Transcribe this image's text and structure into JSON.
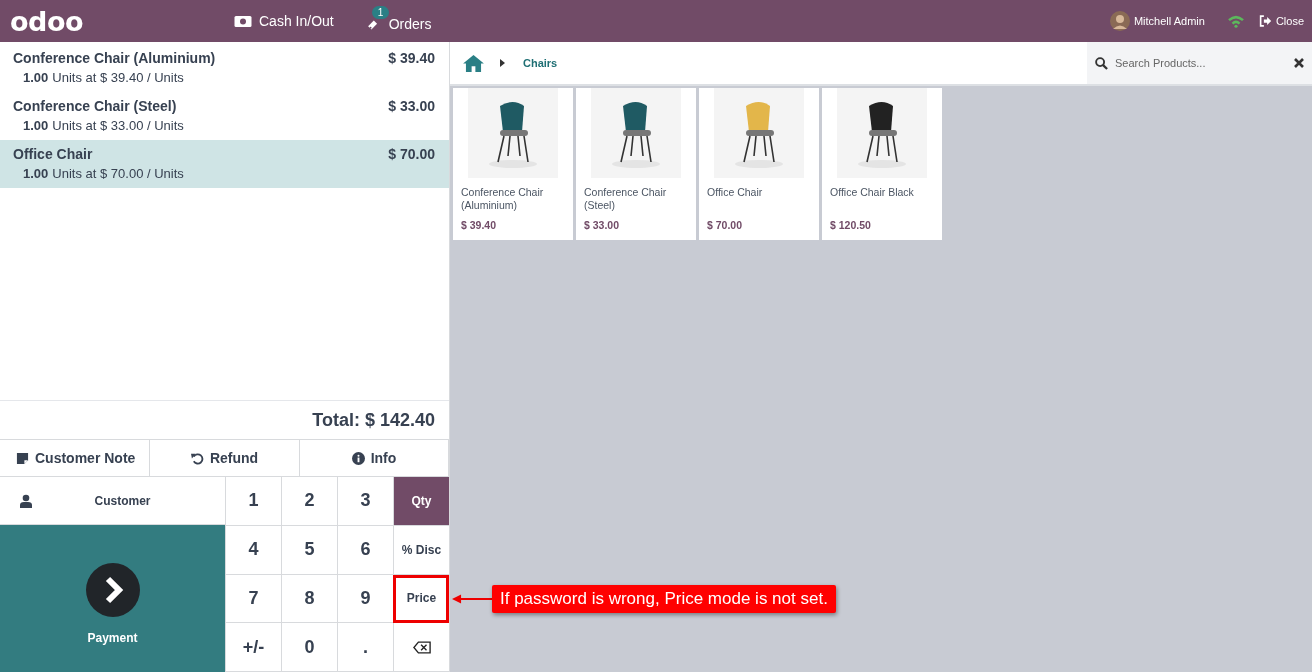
{
  "header": {
    "logo": "odoo",
    "cash_button": "Cash In/Out",
    "orders_button": {
      "label": "Orders",
      "badge": "1"
    },
    "user": "Mitchell Admin",
    "close_button": "Close"
  },
  "order_lines": [
    {
      "name": "Conference Chair (Aluminium)",
      "price": "$ 39.40",
      "quantity": "1.00",
      "detail": "Units at $ 39.40 / Units",
      "selected": false
    },
    {
      "name": "Conference Chair (Steel)",
      "price": "$ 33.00",
      "quantity": "1.00",
      "detail": "Units at $ 33.00 / Units",
      "selected": false
    },
    {
      "name": "Office Chair",
      "price": "$ 70.00",
      "quantity": "1.00",
      "detail": "Units at $ 70.00 / Units",
      "selected": true
    }
  ],
  "total": "Total: $ 142.40",
  "control_buttons": [
    {
      "kind": "note",
      "label": "Customer Note"
    },
    {
      "kind": "refund",
      "label": "Refund"
    },
    {
      "kind": "info",
      "label": "Info"
    }
  ],
  "customer_button": "Customer",
  "payment_button": "Payment",
  "numpad": [
    {
      "kind": "digit",
      "label": "1"
    },
    {
      "kind": "digit",
      "label": "2"
    },
    {
      "kind": "digit",
      "label": "3"
    },
    {
      "kind": "mode",
      "label": "Qty",
      "selected": true,
      "annotated": false
    },
    {
      "kind": "digit",
      "label": "4"
    },
    {
      "kind": "digit",
      "label": "5"
    },
    {
      "kind": "digit",
      "label": "6"
    },
    {
      "kind": "mode",
      "label": "% Disc",
      "selected": false,
      "annotated": false
    },
    {
      "kind": "digit",
      "label": "7"
    },
    {
      "kind": "digit",
      "label": "8"
    },
    {
      "kind": "digit",
      "label": "9"
    },
    {
      "kind": "mode",
      "label": "Price",
      "selected": false,
      "annotated": true
    },
    {
      "kind": "digit",
      "label": "+/-"
    },
    {
      "kind": "digit",
      "label": "0"
    },
    {
      "kind": "digit",
      "label": "."
    },
    {
      "kind": "backspace"
    }
  ],
  "annotation": "If password is wrong, Price mode is not set.",
  "breadcrumb": {
    "category": "Chairs"
  },
  "search": {
    "placeholder": "Search Products..."
  },
  "products": [
    {
      "name": "Conference Chair (Aluminium)",
      "price": "$ 39.40"
    },
    {
      "name": "Conference Chair (Steel)",
      "price": "$ 33.00"
    },
    {
      "name": "Office Chair",
      "price": "$ 70.00"
    },
    {
      "name": "Office Chair Black",
      "price": "$ 120.50"
    }
  ]
}
